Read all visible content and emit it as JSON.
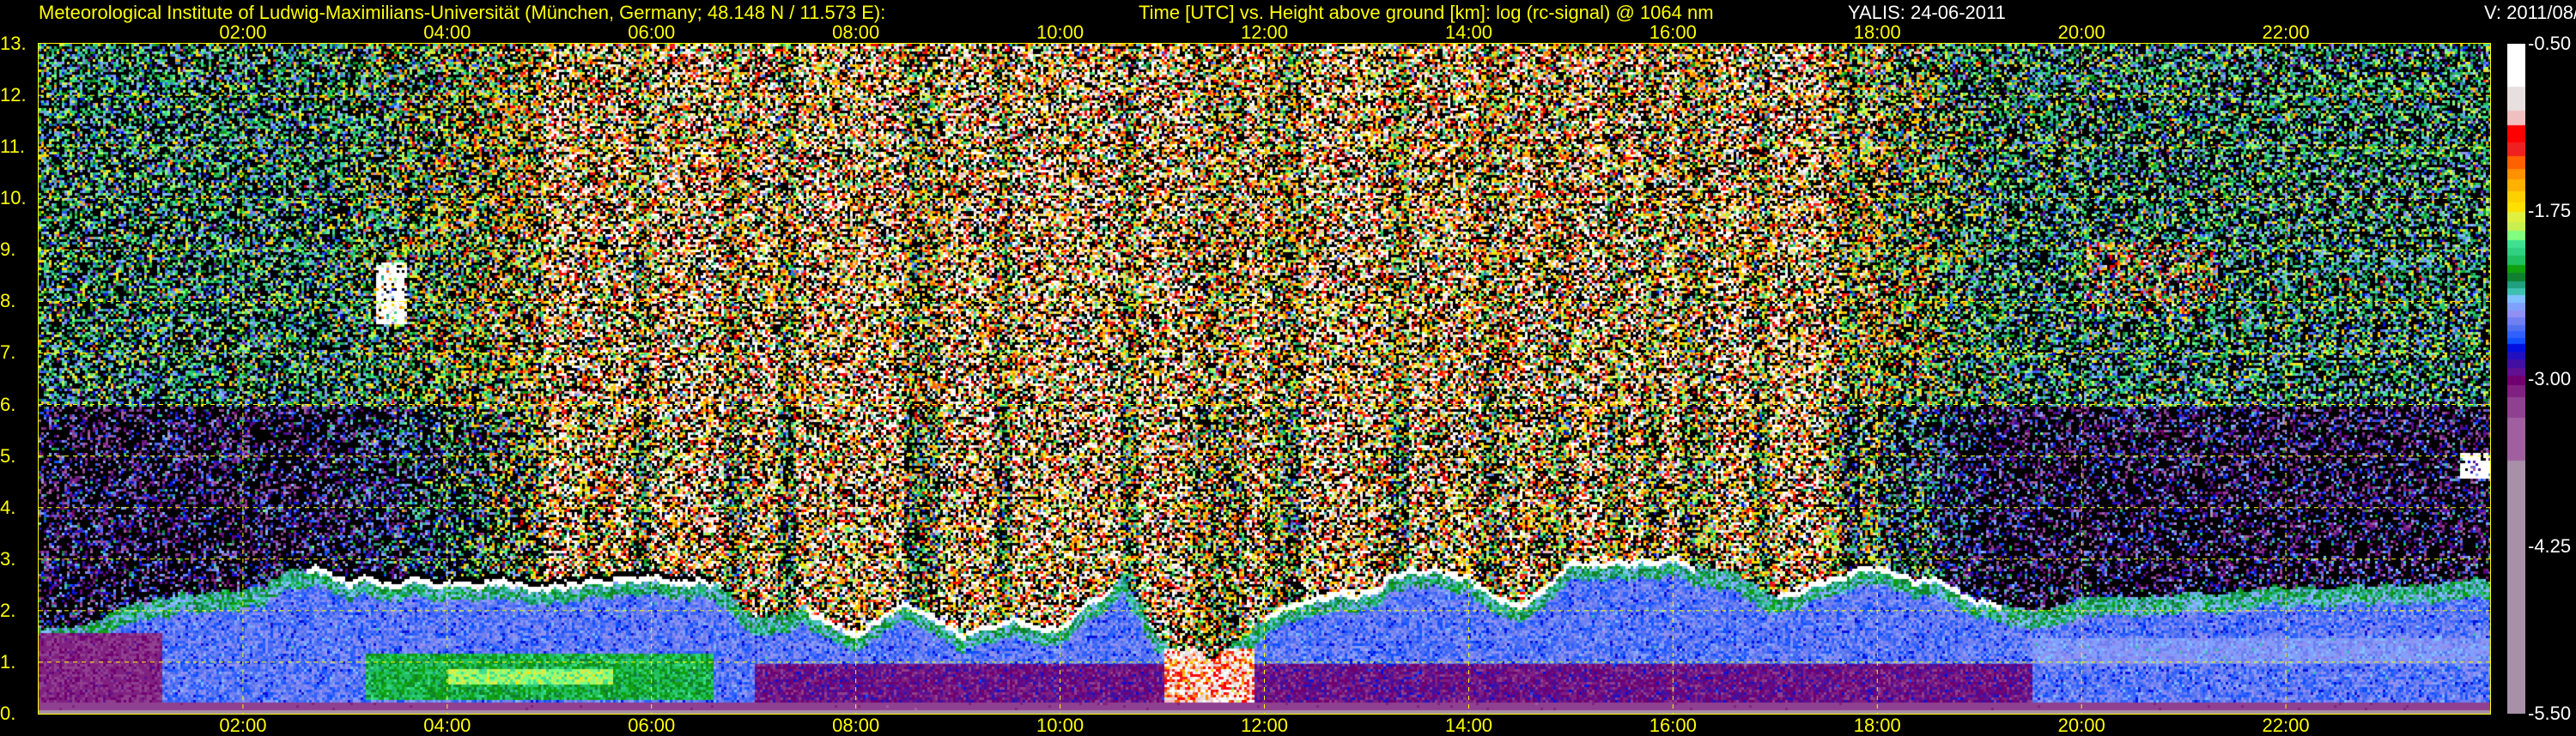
{
  "header": {
    "institute": "Meteorological Institute of Ludwig-Maximilians-Universität (München, Germany; 48.148 N / 11.573 E):",
    "plot_description": "Time [UTC] vs. Height above ground [km]: log (rc-signal) @ 1064 nm",
    "instrument_date": "YALIS: 24-06-2011",
    "version": "V: 2011/08/"
  },
  "chart_data": {
    "type": "heatmap",
    "title": "Time [UTC] vs. Height above ground [km]: log (rc-signal) @ 1064 nm",
    "xlabel": "Time [UTC]",
    "ylabel": "Height above ground [km]",
    "xlim_hours": [
      0,
      24
    ],
    "ylim_km": [
      0,
      13
    ],
    "x_ticks": [
      "02:00",
      "04:00",
      "06:00",
      "08:00",
      "10:00",
      "12:00",
      "14:00",
      "16:00",
      "18:00",
      "20:00",
      "22:00"
    ],
    "x_tick_hours": [
      2,
      4,
      6,
      8,
      10,
      12,
      14,
      16,
      18,
      20,
      22
    ],
    "y_ticks": [
      "0.",
      "1.",
      "2.",
      "3.",
      "4.",
      "5.",
      "6.",
      "7.",
      "8.",
      "9.",
      "10.",
      "11.",
      "12.",
      "13."
    ],
    "y_tick_km": [
      0,
      1,
      2,
      3,
      4,
      5,
      6,
      7,
      8,
      9,
      10,
      11,
      12,
      13
    ],
    "grid": true,
    "colorbar": {
      "range": [
        -5.5,
        -0.5
      ],
      "tick_labels": [
        "-0.50",
        "-1.75",
        "-3.00",
        "-4.25",
        "-5.50"
      ],
      "tick_values": [
        -0.5,
        -1.75,
        -3.0,
        -4.25,
        -5.5
      ],
      "colors": [
        "#ffffff",
        "#e8e0e0",
        "#f0c0c0",
        "#ff0000",
        "#f02020",
        "#ff6000",
        "#ff9000",
        "#ffb000",
        "#ffd000",
        "#ffe000",
        "#e0f040",
        "#c8f050",
        "#80ff80",
        "#40e090",
        "#30d080",
        "#20c060",
        "#10a010",
        "#108030",
        "#20a080",
        "#40c0b0",
        "#80c0ff",
        "#80a0ff",
        "#9090f0",
        "#7080f0",
        "#5070f0",
        "#3060ff",
        "#1050ff",
        "#0010e0",
        "#2010c0",
        "#4010a0",
        "#601090",
        "#700070",
        "#802080",
        "#904090",
        "#a060a0",
        "#a890a8"
      ],
      "lower_bounds": [
        -0.817,
        -0.993,
        -1.106,
        -1.236,
        -1.335,
        -1.43,
        -1.511,
        -1.599,
        -1.68,
        -1.751,
        -1.829,
        -1.892,
        -1.962,
        -2.022,
        -2.075,
        -2.146,
        -2.209,
        -2.269,
        -2.322,
        -2.375,
        -2.428,
        -2.491,
        -2.54,
        -2.597,
        -2.639,
        -2.692,
        -2.738,
        -2.798,
        -2.851,
        -2.914,
        -2.974,
        -3.044,
        -3.132,
        -3.291,
        -3.608,
        -5.5
      ]
    }
  }
}
